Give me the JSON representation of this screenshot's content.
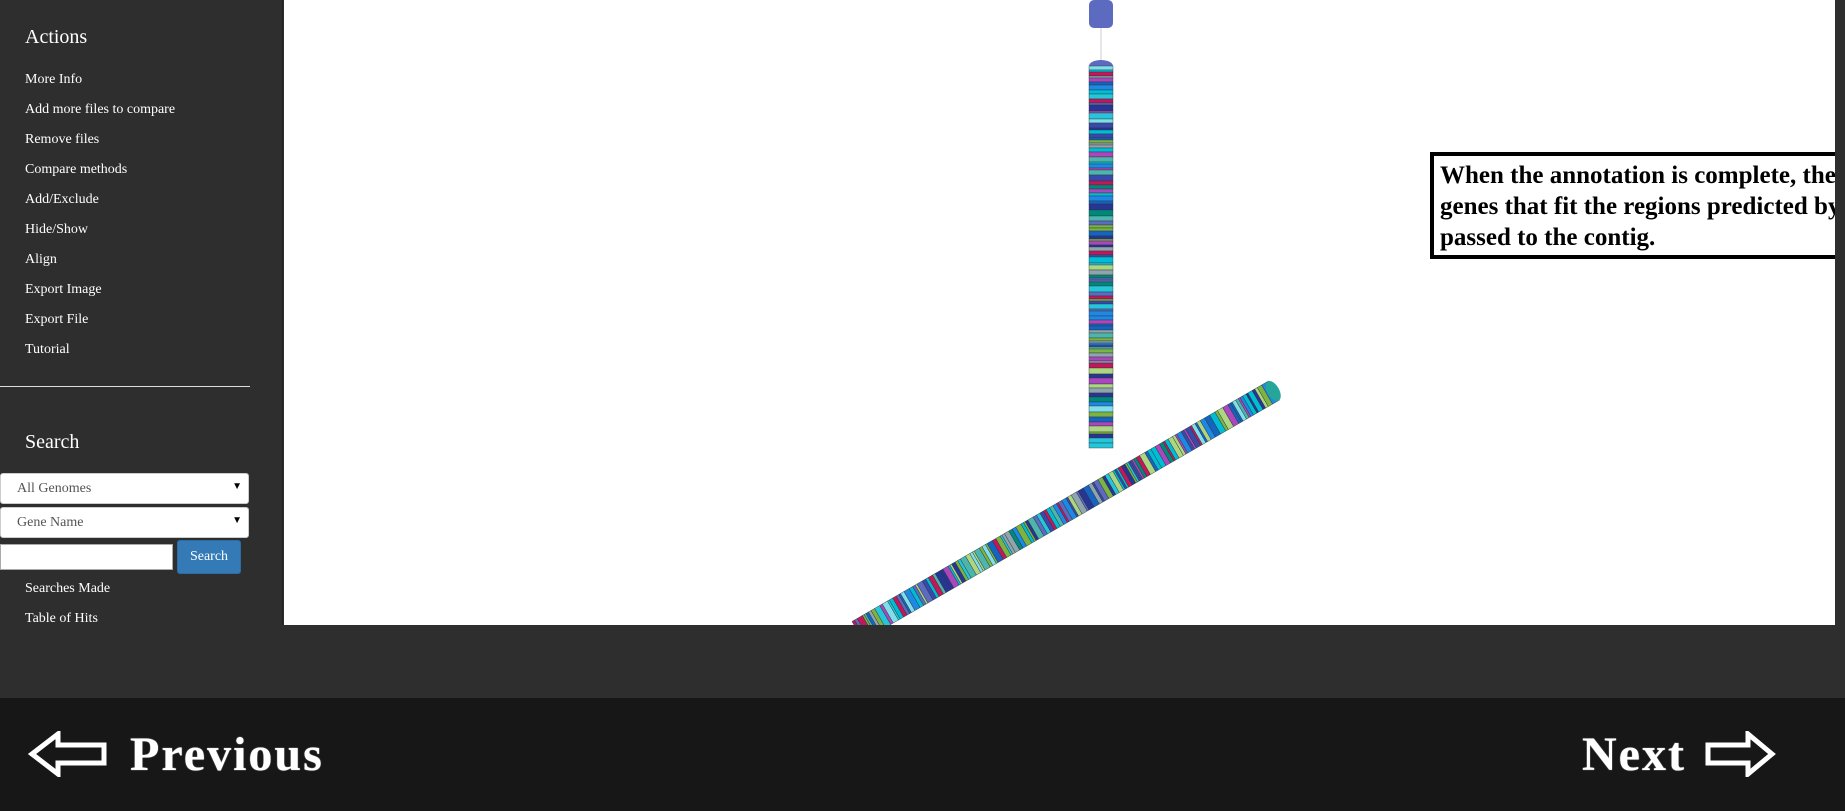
{
  "sidebar": {
    "actions_title": "Actions",
    "actions": [
      "More Info",
      "Add more files to compare",
      "Remove files",
      "Compare methods",
      "Add/Exclude",
      "Hide/Show",
      "Align",
      "Export Image",
      "Export File",
      "Tutorial"
    ],
    "search_title": "Search",
    "genome_select": "All Genomes",
    "field_select": "Gene Name",
    "search_input_value": "",
    "search_button": "Search",
    "searches_made": "Searches Made",
    "table_of_hits": "Table of Hits"
  },
  "viewer": {
    "info_text": "When the annotation is complete, the information of genes that fit the regions predicted by Prodigal is passed to the contig.",
    "contig_colors": [
      "#5c6bc0",
      "#1e88e5",
      "#26c6da",
      "#00bcd4",
      "#3949ab",
      "#7cb342",
      "#ab47bc",
      "#c2185b",
      "#80deea",
      "#4db6ac",
      "#aed581",
      "#1565c0",
      "#00897b",
      "#90a4ae",
      "#283593"
    ]
  },
  "navigation": {
    "previous_label": "Previous",
    "next_label": "Next",
    "previous_icon": "left-arrow-icon",
    "next_icon": "right-arrow-icon"
  }
}
